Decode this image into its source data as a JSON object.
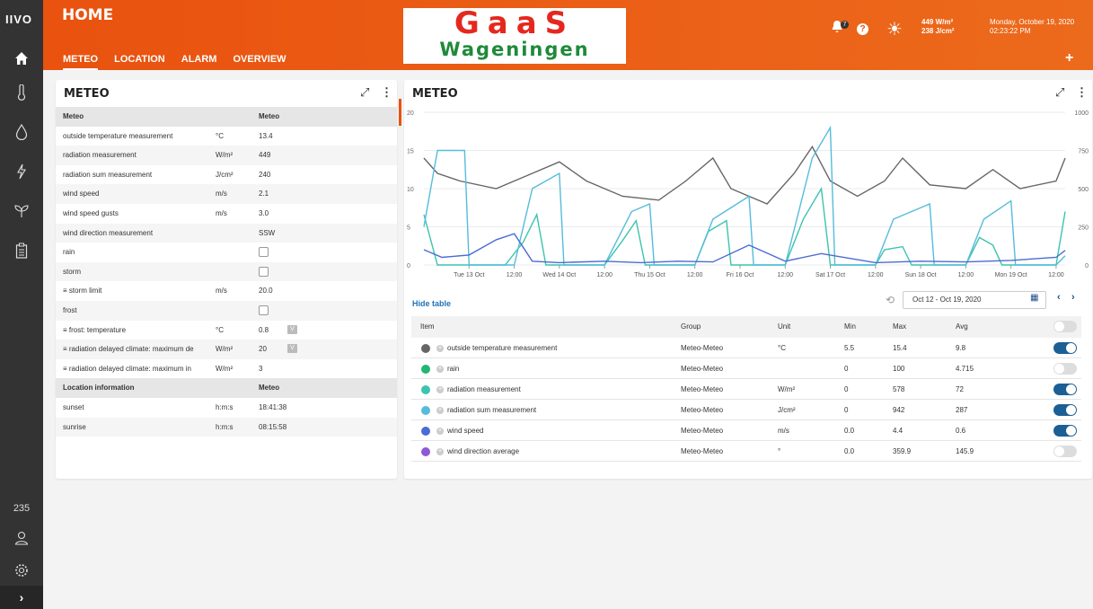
{
  "sidebar": {
    "logo": "IIVO",
    "count": "235",
    "expand": "›"
  },
  "header": {
    "title": "HOME",
    "tabs": [
      "METEO",
      "LOCATION",
      "ALARM",
      "OVERVIEW"
    ],
    "brand_top": "GaaS",
    "brand_bottom": "Wageningen",
    "notifications": "7",
    "radiation": "449 W/m²",
    "radiation_sum": "238 J/cm²",
    "date": "Monday, October 19, 2020",
    "time": "02:23:22 PM",
    "add": "+"
  },
  "left": {
    "title": "METEO",
    "rows": [
      {
        "type": "header",
        "label": "Meteo",
        "value": "Meteo"
      },
      {
        "label": "outside temperature measurement",
        "unit": "°C",
        "value": "13.4"
      },
      {
        "label": "radiation measurement",
        "unit": "W/m²",
        "value": "449"
      },
      {
        "label": "radiation sum measurement",
        "unit": "J/cm²",
        "value": "240"
      },
      {
        "label": "wind speed",
        "unit": "m/s",
        "value": "2.1"
      },
      {
        "label": "wind speed gusts",
        "unit": "m/s",
        "value": "3.0"
      },
      {
        "label": "wind direction measurement",
        "unit": "",
        "value": "SSW"
      },
      {
        "label": "rain",
        "unit": "",
        "check": true
      },
      {
        "label": "storm",
        "unit": "",
        "check": true
      },
      {
        "label": "≡ storm limit",
        "unit": "m/s",
        "value": "20.0"
      },
      {
        "label": "frost",
        "unit": "",
        "check": true
      },
      {
        "label": "≡ frost: temperature",
        "unit": "°C",
        "value": "0.8",
        "v": "V"
      },
      {
        "label": "≡ radiation delayed climate: maximum de",
        "unit": "W/m²",
        "value": "20",
        "v": "V"
      },
      {
        "label": "≡ radiation delayed climate: maximum in",
        "unit": "W/m²",
        "value": "3"
      },
      {
        "type": "header",
        "label": "Location information",
        "value": "Meteo"
      },
      {
        "label": "sunset",
        "unit": "h:m:s",
        "value": "18:41:38"
      },
      {
        "label": "sunrise",
        "unit": "h:m:s",
        "value": "08:15:58"
      }
    ]
  },
  "right": {
    "title": "METEO",
    "hide_table": "Hide table",
    "daterange": "Oct 12 - Oct 19, 2020",
    "columns": [
      "Item",
      "Group",
      "Unit",
      "Min",
      "Max",
      "Avg"
    ],
    "items": [
      {
        "name": "outside temperature measurement",
        "group": "Meteo-Meteo",
        "unit": "°C",
        "min": "5.5",
        "max": "15.4",
        "avg": "9.8",
        "color": "#666666",
        "on": true
      },
      {
        "name": "rain",
        "group": "Meteo-Meteo",
        "unit": "",
        "min": "0",
        "max": "100",
        "avg": "4.715",
        "color": "#22b573",
        "on": false
      },
      {
        "name": "radiation measurement",
        "group": "Meteo-Meteo",
        "unit": "W/m²",
        "min": "0",
        "max": "578",
        "avg": "72",
        "color": "#3cc4ae",
        "on": true
      },
      {
        "name": "radiation sum measurement",
        "group": "Meteo-Meteo",
        "unit": "J/cm²",
        "min": "0",
        "max": "942",
        "avg": "287",
        "color": "#55bcdc",
        "on": true
      },
      {
        "name": "wind speed",
        "group": "Meteo-Meteo",
        "unit": "m/s",
        "min": "0.0",
        "max": "4.4",
        "avg": "0.6",
        "color": "#4a6cd4",
        "on": true
      },
      {
        "name": "wind direction average",
        "group": "Meteo-Meteo",
        "unit": "°",
        "min": "0.0",
        "max": "359.9",
        "avg": "145.9",
        "color": "#8e5bd6",
        "on": false
      }
    ]
  },
  "chart_data": {
    "type": "line",
    "left_axis": {
      "ticks": [
        "0",
        "5",
        "10",
        "15",
        "20"
      ],
      "range": [
        0,
        20
      ]
    },
    "right_axis": {
      "ticks": [
        "0",
        "250",
        "500",
        "750",
        "1000"
      ],
      "range": [
        0,
        1000
      ]
    },
    "x_ticks": [
      "Tue 13 Oct",
      "12:00",
      "Wed 14 Oct",
      "12:00",
      "Thu 15 Oct",
      "12:00",
      "Fri 16 Oct",
      "12:00",
      "Sat 17 Oct",
      "12:00",
      "Sun 18 Oct",
      "12:00",
      "Mon 19 Oct",
      "12:00"
    ],
    "x_range_days": [
      0,
      7.1
    ],
    "series": [
      {
        "color": "#666666",
        "axis": "left",
        "points": [
          [
            0,
            14
          ],
          [
            0.15,
            12
          ],
          [
            0.4,
            11
          ],
          [
            0.8,
            10
          ],
          [
            1.2,
            12
          ],
          [
            1.5,
            13.5
          ],
          [
            1.8,
            11
          ],
          [
            2.2,
            9
          ],
          [
            2.6,
            8.5
          ],
          [
            2.9,
            11
          ],
          [
            3.2,
            14
          ],
          [
            3.4,
            10
          ],
          [
            3.8,
            8
          ],
          [
            4.1,
            12
          ],
          [
            4.3,
            15.5
          ],
          [
            4.5,
            11
          ],
          [
            4.8,
            9
          ],
          [
            5.1,
            11
          ],
          [
            5.3,
            14
          ],
          [
            5.6,
            10.5
          ],
          [
            6.0,
            10
          ],
          [
            6.3,
            12.5
          ],
          [
            6.6,
            10
          ],
          [
            7.0,
            11
          ],
          [
            7.1,
            14
          ]
        ]
      },
      {
        "color": "#3cc4ae",
        "axis": "right",
        "points": [
          [
            0,
            330
          ],
          [
            0.15,
            0
          ],
          [
            0.9,
            0
          ],
          [
            1.1,
            150
          ],
          [
            1.25,
            330
          ],
          [
            1.35,
            0
          ],
          [
            2.0,
            0
          ],
          [
            2.2,
            160
          ],
          [
            2.35,
            290
          ],
          [
            2.45,
            0
          ],
          [
            3.0,
            0
          ],
          [
            3.15,
            220
          ],
          [
            3.35,
            290
          ],
          [
            3.4,
            0
          ],
          [
            4.0,
            0
          ],
          [
            4.2,
            300
          ],
          [
            4.4,
            500
          ],
          [
            4.5,
            0
          ],
          [
            5.0,
            0
          ],
          [
            5.1,
            100
          ],
          [
            5.3,
            120
          ],
          [
            5.4,
            0
          ],
          [
            6.0,
            0
          ],
          [
            6.15,
            180
          ],
          [
            6.3,
            130
          ],
          [
            6.4,
            0
          ],
          [
            7.0,
            0
          ],
          [
            7.1,
            350
          ]
        ]
      },
      {
        "color": "#55bcdc",
        "axis": "right",
        "points": [
          [
            0,
            250
          ],
          [
            0.15,
            750
          ],
          [
            0.45,
            750
          ],
          [
            0.5,
            0
          ],
          [
            1.0,
            0
          ],
          [
            1.2,
            500
          ],
          [
            1.5,
            600
          ],
          [
            1.55,
            0
          ],
          [
            2.0,
            0
          ],
          [
            2.3,
            350
          ],
          [
            2.5,
            400
          ],
          [
            2.55,
            0
          ],
          [
            3.0,
            0
          ],
          [
            3.2,
            300
          ],
          [
            3.6,
            450
          ],
          [
            3.65,
            0
          ],
          [
            4.0,
            0
          ],
          [
            4.3,
            700
          ],
          [
            4.5,
            900
          ],
          [
            4.55,
            0
          ],
          [
            5.0,
            0
          ],
          [
            5.2,
            300
          ],
          [
            5.6,
            400
          ],
          [
            5.65,
            0
          ],
          [
            6.0,
            0
          ],
          [
            6.2,
            300
          ],
          [
            6.5,
            420
          ],
          [
            6.55,
            0
          ],
          [
            7.0,
            0
          ],
          [
            7.1,
            60
          ]
        ]
      },
      {
        "color": "#4a6cd4",
        "axis": "left",
        "points": [
          [
            0,
            2
          ],
          [
            0.2,
            1
          ],
          [
            0.5,
            1.3
          ],
          [
            0.8,
            3.3
          ],
          [
            1.0,
            4.1
          ],
          [
            1.2,
            0.5
          ],
          [
            1.5,
            0.3
          ],
          [
            2.0,
            0.5
          ],
          [
            2.4,
            0.3
          ],
          [
            2.8,
            0.5
          ],
          [
            3.2,
            0.4
          ],
          [
            3.6,
            2.6
          ],
          [
            4.0,
            0.5
          ],
          [
            4.4,
            1.5
          ],
          [
            5.0,
            0.3
          ],
          [
            5.5,
            0.5
          ],
          [
            6.0,
            0.4
          ],
          [
            6.5,
            0.6
          ],
          [
            7.0,
            1
          ],
          [
            7.1,
            1.9
          ]
        ]
      }
    ]
  }
}
